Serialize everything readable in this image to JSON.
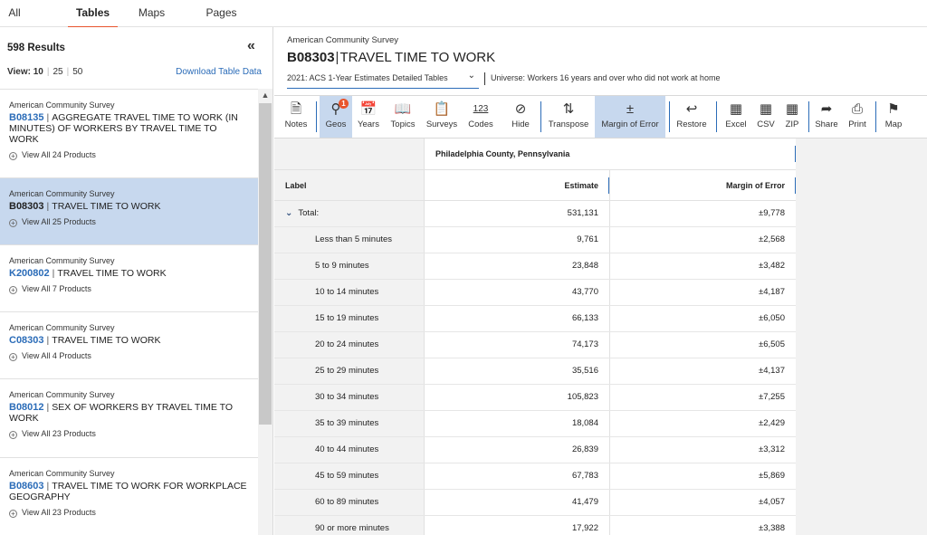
{
  "topnav": {
    "tabs": [
      "All",
      "Tables",
      "Maps",
      "Pages"
    ],
    "active": "Tables"
  },
  "left": {
    "results": "598 Results",
    "collapse": "«",
    "view_label": "View:",
    "view_options": [
      "10",
      "25",
      "50"
    ],
    "download": "Download Table Data",
    "items": [
      {
        "survey": "American Community Survey",
        "id": "B08135",
        "title": "AGGREGATE TRAVEL TIME TO WORK (IN MINUTES) OF WORKERS BY TRAVEL TIME TO WORK",
        "products": "View All 24 Products"
      },
      {
        "survey": "American Community Survey",
        "id": "B08303",
        "title": "TRAVEL TIME TO WORK",
        "products": "View All 25 Products",
        "selected": true
      },
      {
        "survey": "American Community Survey",
        "id": "K200802",
        "title": "TRAVEL TIME TO WORK",
        "products": "View All 7 Products"
      },
      {
        "survey": "American Community Survey",
        "id": "C08303",
        "title": "TRAVEL TIME TO WORK",
        "products": "View All 4 Products"
      },
      {
        "survey": "American Community Survey",
        "id": "B08012",
        "title": "SEX OF WORKERS BY TRAVEL TIME TO WORK",
        "products": "View All 23 Products"
      },
      {
        "survey": "American Community Survey",
        "id": "B08603",
        "title": "TRAVEL TIME TO WORK FOR WORKPLACE GEOGRAPHY",
        "products": "View All 23 Products"
      }
    ]
  },
  "header": {
    "survey": "American Community Survey",
    "table_id": "B08303",
    "table_title": "TRAVEL TIME TO WORK",
    "dataset": "2021: ACS 1-Year Estimates Detailed Tables",
    "universe": "Universe: Workers 16 years and over who did not work at home"
  },
  "toolbar": {
    "notes": "Notes",
    "geos": "Geos",
    "geos_badge": "1",
    "years": "Years",
    "topics": "Topics",
    "surveys": "Surveys",
    "codes": "Codes",
    "codes_icon_text": "123",
    "hide": "Hide",
    "transpose": "Transpose",
    "moe": "Margin of Error",
    "restore": "Restore",
    "excel": "Excel",
    "csv": "CSV",
    "zip": "ZIP",
    "share": "Share",
    "print": "Print",
    "map": "Map"
  },
  "table": {
    "geography": "Philadelphia County, Pennsylvania",
    "col_label": "Label",
    "col_estimate": "Estimate",
    "col_moe": "Margin of Error",
    "rows": [
      {
        "label": "Total:",
        "estimate": "531,131",
        "moe": "±9,778"
      },
      {
        "label": "Less than 5 minutes",
        "estimate": "9,761",
        "moe": "±2,568"
      },
      {
        "label": "5 to 9 minutes",
        "estimate": "23,848",
        "moe": "±3,482"
      },
      {
        "label": "10 to 14 minutes",
        "estimate": "43,770",
        "moe": "±4,187"
      },
      {
        "label": "15 to 19 minutes",
        "estimate": "66,133",
        "moe": "±6,050"
      },
      {
        "label": "20 to 24 minutes",
        "estimate": "74,173",
        "moe": "±6,505"
      },
      {
        "label": "25 to 29 minutes",
        "estimate": "35,516",
        "moe": "±4,137"
      },
      {
        "label": "30 to 34 minutes",
        "estimate": "105,823",
        "moe": "±7,255"
      },
      {
        "label": "35 to 39 minutes",
        "estimate": "18,084",
        "moe": "±2,429"
      },
      {
        "label": "40 to 44 minutes",
        "estimate": "26,839",
        "moe": "±3,312"
      },
      {
        "label": "45 to 59 minutes",
        "estimate": "67,783",
        "moe": "±5,869"
      },
      {
        "label": "60 to 89 minutes",
        "estimate": "41,479",
        "moe": "±4,057"
      },
      {
        "label": "90 or more minutes",
        "estimate": "17,922",
        "moe": "±3,388"
      }
    ]
  }
}
